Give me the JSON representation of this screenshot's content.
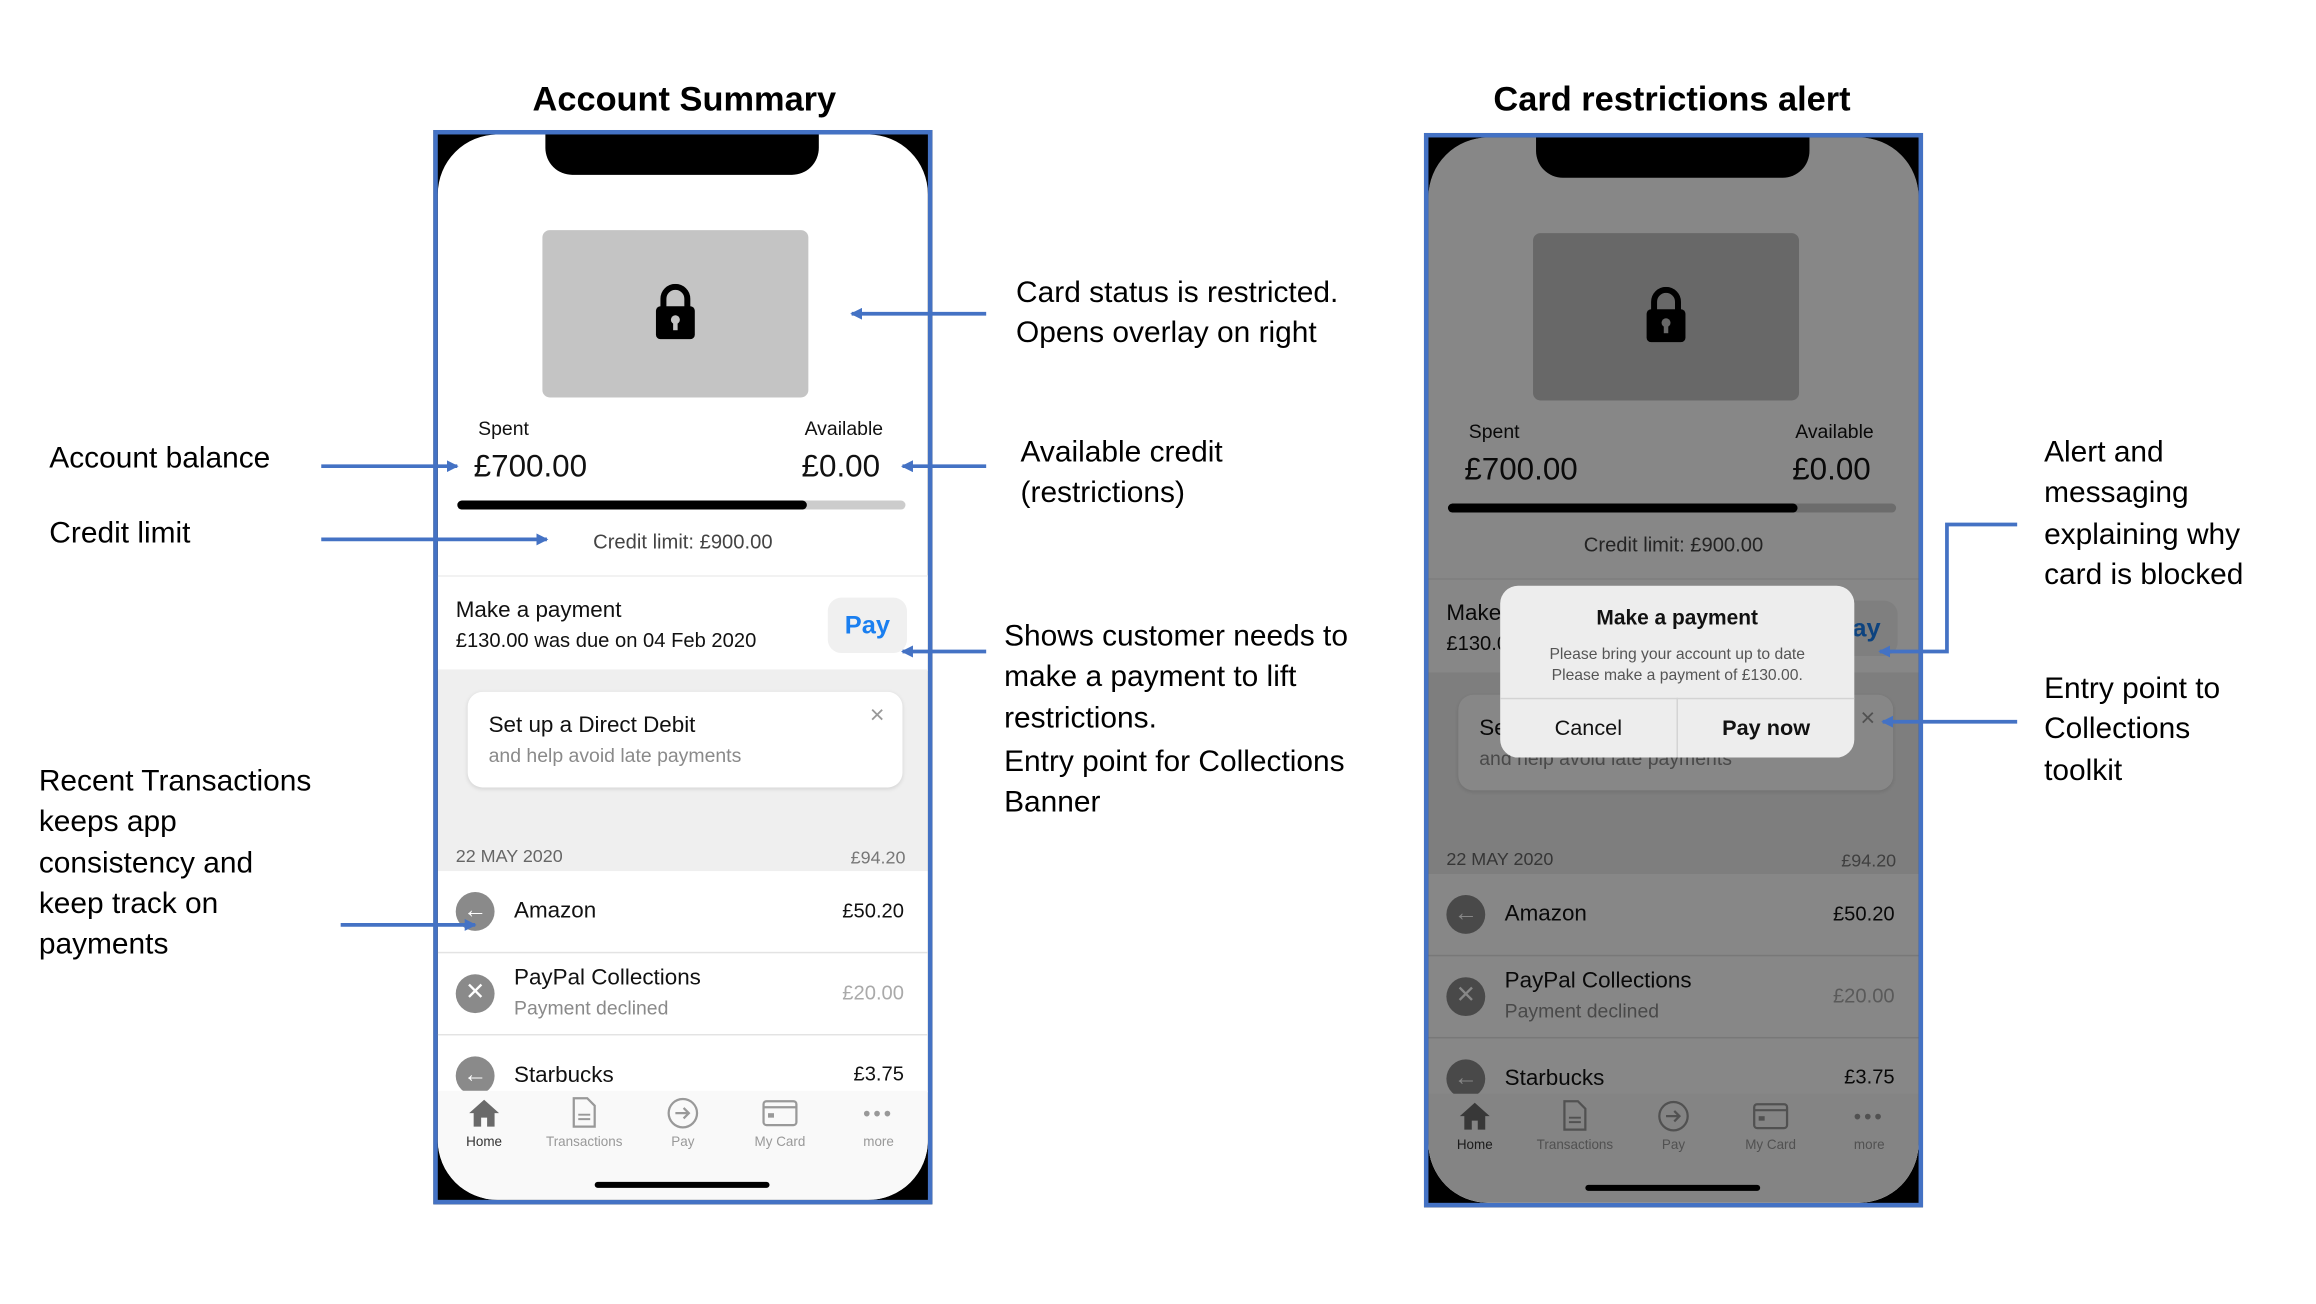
{
  "titles": {
    "left": "Account Summary",
    "right": "Card restrictions alert"
  },
  "phone": {
    "card_status_icon": "lock-icon",
    "spent_label": "Spent",
    "spent_value": "£700.00",
    "available_label": "Available",
    "available_value": "£0.00",
    "spent_fraction": 0.78,
    "credit_limit": "Credit limit:  £900.00",
    "payment": {
      "title": "Make a payment",
      "subtitle": "£130.00 was due on 04 Feb 2020",
      "button": "Pay"
    },
    "banner": {
      "title": "Set up a Direct Debit",
      "subtitle": "and help avoid late payments",
      "close": "×"
    },
    "date_header": {
      "date": "22 MAY 2020",
      "total": "£94.20"
    },
    "transactions": [
      {
        "name": "Amazon",
        "amount": "£50.20",
        "icon": "arrow-left-icon"
      },
      {
        "name": "PayPal Collections",
        "sub": "Payment declined",
        "amount": "£20.00",
        "icon": "close-icon"
      },
      {
        "name": "Starbucks",
        "amount": "£3.75",
        "icon": "arrow-left-icon"
      }
    ],
    "tabs": [
      {
        "label": "Home",
        "icon": "home-icon"
      },
      {
        "label": "Transactions",
        "icon": "document-icon"
      },
      {
        "label": "Pay",
        "icon": "arrow-circle-icon"
      },
      {
        "label": "My Card",
        "icon": "card-icon"
      },
      {
        "label": "more",
        "icon": "more-icon"
      }
    ]
  },
  "alert": {
    "title": "Make a payment",
    "line1": "Please bring your account up to date",
    "line2": "Please make a payment of £130.00.",
    "cancel": "Cancel",
    "confirm": "Pay now"
  },
  "annotations": {
    "card_status": [
      "Card status is restricted.",
      "Opens overlay on right"
    ],
    "account_balance": "Account balance",
    "credit_limit": "Credit limit",
    "available_credit": [
      "Available credit",
      "(restrictions)"
    ],
    "make_payment": [
      "Shows customer needs to",
      "make a payment to lift",
      "restrictions.",
      "Entry point for Collections",
      "Banner"
    ],
    "recent": [
      "Recent Transactions",
      "keeps app",
      "consistency and",
      "keep track on",
      "payments"
    ],
    "alert_msg": [
      "Alert and",
      "messaging",
      "explaining why",
      "card is blocked"
    ],
    "entry_point": [
      "Entry point to",
      "Collections",
      "toolkit"
    ]
  },
  "colors": {
    "annotation_blue": "#4472c4",
    "pay_blue": "#1a7ff0"
  }
}
